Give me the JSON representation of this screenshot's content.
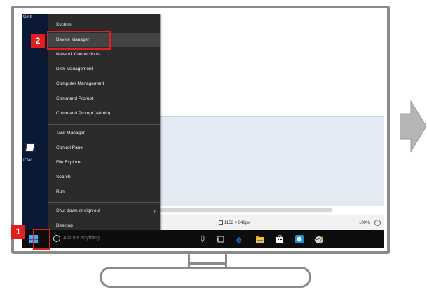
{
  "desktop": {
    "top_icon_label": "Geni",
    "icon_labels": [
      "IDW"
    ]
  },
  "menu": {
    "items": [
      {
        "label": "System"
      },
      {
        "label": "Device Manager"
      },
      {
        "label": "Network Connections"
      },
      {
        "label": "Disk Management"
      },
      {
        "label": "Computer Management"
      },
      {
        "label": "Command Prompt"
      },
      {
        "label": "Command Prompt (Admin)"
      },
      {
        "label": "Task Manager"
      },
      {
        "label": "Control Panel"
      },
      {
        "label": "File Explorer"
      },
      {
        "label": "Search"
      },
      {
        "label": "Run"
      },
      {
        "label": "Shut down or sign out"
      },
      {
        "label": "Desktop"
      }
    ],
    "submenu_arrow": "›"
  },
  "status": {
    "image_size": "1152 × 648px",
    "zoom": "100%",
    "zoom_button": "−"
  },
  "taskbar": {
    "search_placeholder": "Ask me anything"
  },
  "callouts": {
    "step1": "1",
    "step2": "2"
  },
  "colors": {
    "callout": "#e02020",
    "taskbar": "#0d0d0d",
    "menu_bg": "#2b2b2b",
    "edge_blue": "#1e78d7"
  }
}
